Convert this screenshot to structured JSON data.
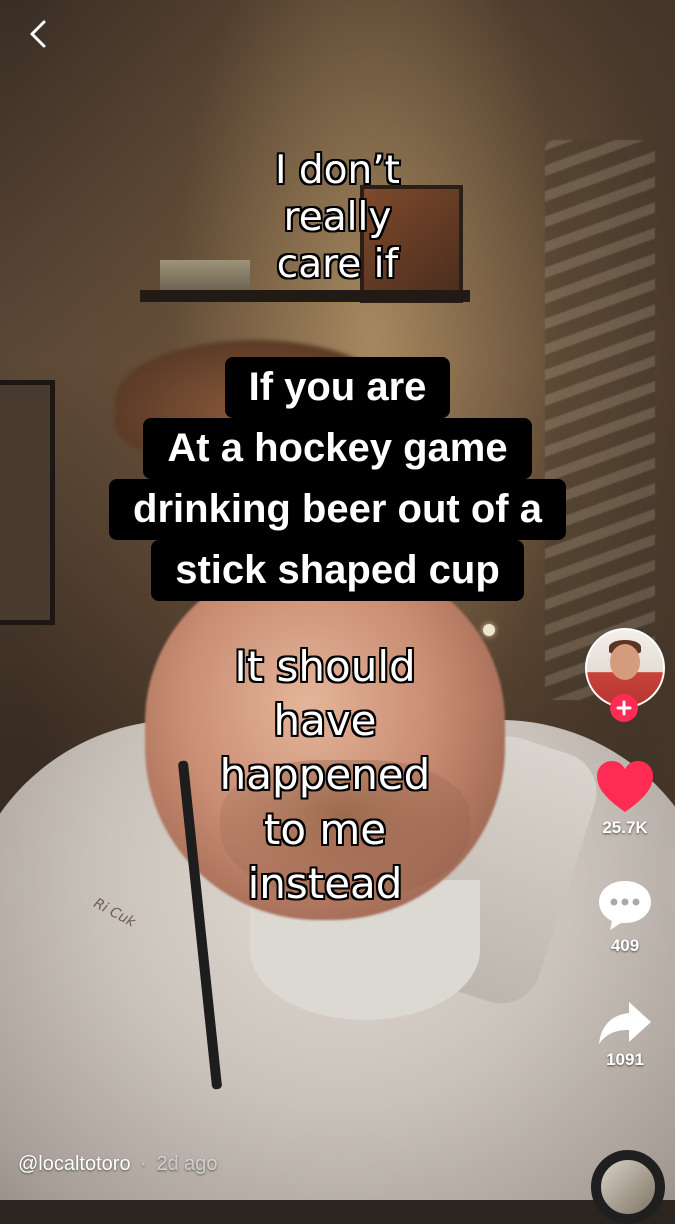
{
  "caption": {
    "top_lines": [
      "I don’t",
      "really",
      "care if"
    ],
    "bottom_lines": [
      "It should",
      "have",
      "happened",
      "to me",
      "instead"
    ]
  },
  "overlay_text": {
    "lines": [
      "If you are",
      "At a hockey game",
      "drinking beer out of a",
      "stick shaped cup"
    ]
  },
  "actions": {
    "likes": "25.7K",
    "comments": "409",
    "shares": "1091"
  },
  "post": {
    "username": "@localtotoro",
    "separator": "·",
    "time_ago": "2d ago"
  },
  "colors": {
    "like": "#fe2c55",
    "follow": "#fe2c55"
  },
  "icons": {
    "back": "chevron-left-icon",
    "follow": "plus-icon",
    "like": "heart-icon",
    "comment": "comment-bubble-icon",
    "share": "share-arrow-icon"
  }
}
